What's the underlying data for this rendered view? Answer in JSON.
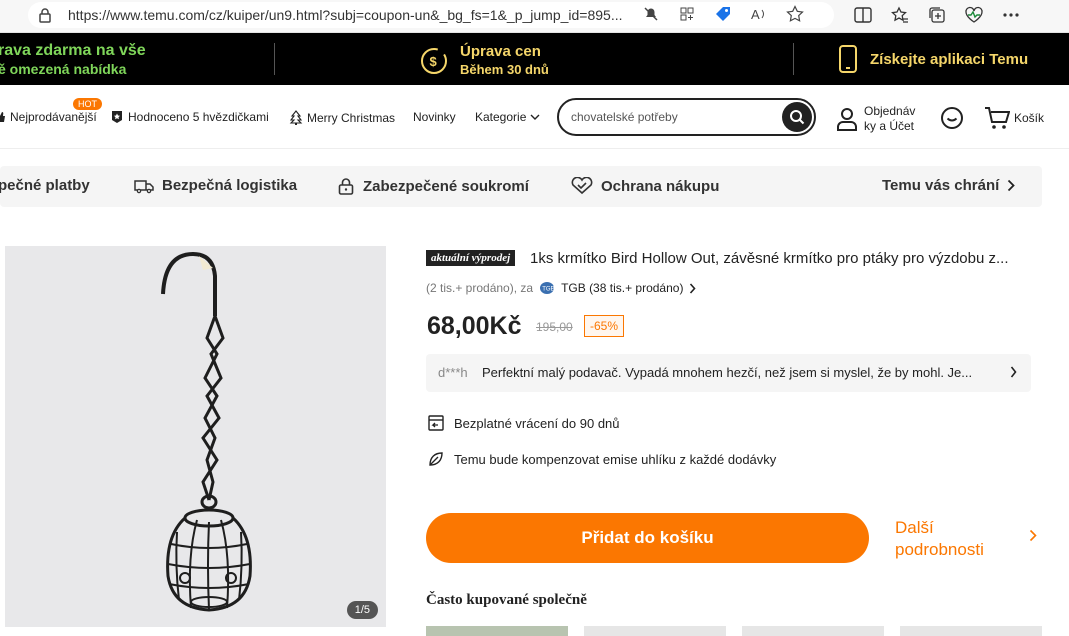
{
  "browser": {
    "url": "https://www.temu.com/cz/kuiper/un9.html?subj=coupon-un&_bg_fs=1&_p_jump_id=895..."
  },
  "promo": {
    "free_shipping_line1": "rava zdarma na vše",
    "free_shipping_line2": "ě omezená nabídka",
    "adjust_line1": "Úprava cen",
    "adjust_line2": "Během 30 dnů",
    "app_text": "Získejte aplikaci Temu"
  },
  "nav": {
    "bestsellers": "Nejprodávanější",
    "hot_badge": "HOT",
    "five_stars": "Hodnoceno 5 hvězdičkami",
    "christmas": "Merry Christmas",
    "new": "Novinky",
    "categories": "Kategorie",
    "search_placeholder": "chovatelské potřeby",
    "orders_line1": "Objednáv",
    "orders_line2": "ky a Účet",
    "cart": "Košík"
  },
  "trust": {
    "payments": "pečné platby",
    "logistics": "Bezpečná logistika",
    "privacy": "Zabezpečené soukromí",
    "purchase": "Ochrana nákupu",
    "protects": "Temu vás chrání"
  },
  "product": {
    "image_counter": "1/5",
    "badge": "aktuální výprodej",
    "title": "1ks krmítko Bird Hollow Out, závěsné krmítko pro ptáky pro výzdobu z...",
    "sold": "(2 tis.+ prodáno), za",
    "shop": "TGB (38 tis.+ prodáno)",
    "price": "68,00Kč",
    "old_price": "195,00",
    "discount": "-65%",
    "review_user": "d***h",
    "review_text": "Perfektní malý podavač. Vypadá mnohem hezčí, než jsem si myslel, že by mohl. Je...",
    "feature_returns": "Bezplatné vrácení do 90 dnů",
    "feature_carbon": "Temu bude kompenzovat emise uhlíku z každé dodávky",
    "add_to_cart": "Přidat do košíku",
    "more_details_line1": "Další",
    "more_details_line2": "podrobnosti",
    "bought_together": "Často kupované společně"
  },
  "colors": {
    "accent": "#fb7701",
    "promo_bg": "#000000",
    "promo_text": "#f5d66a",
    "promo_green": "#7fd65a"
  }
}
